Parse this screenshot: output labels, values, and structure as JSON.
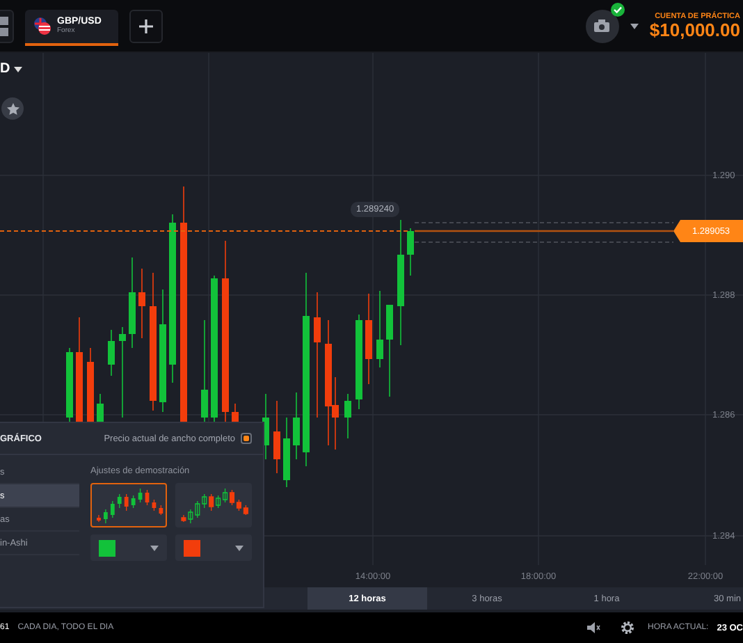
{
  "top_bar": {
    "tabs": [
      {
        "symbol": "GBP/USD",
        "market": "Forex",
        "selected": true
      }
    ],
    "account": {
      "label": "CUENTA DE PRÁCTICA",
      "balance": "$10,000.00"
    }
  },
  "chart": {
    "asset_label": "D",
    "price_labels": [
      "1.290",
      "1.288",
      "1.286",
      "1.284"
    ],
    "time_labels": [
      "14:00:00",
      "18:00:00",
      "22:00:00"
    ],
    "current_price": "1.289053",
    "hover_price": "1.289240"
  },
  "timeframes": [
    {
      "label": "12 horas",
      "selected": true
    },
    {
      "label": "3 horas",
      "selected": false
    },
    {
      "label": "1 hora",
      "selected": false
    },
    {
      "label": "30 min",
      "selected": false
    }
  ],
  "settings_panel": {
    "title": "GRÁFICO",
    "full_width_price": {
      "label": "Precio actual de ancho completo",
      "checked": true
    },
    "chart_types": [
      {
        "label": "s",
        "selected": false
      },
      {
        "label": "s",
        "selected": true
      },
      {
        "label": "as",
        "selected": false
      },
      {
        "label": "in-Ashi",
        "selected": false
      }
    ],
    "demo_label": "Ajustes de demostración",
    "styles": [
      {
        "kind": "filled",
        "selected": true
      },
      {
        "kind": "hollow",
        "selected": false
      }
    ],
    "colors": [
      {
        "color": "#12c23a"
      },
      {
        "color": "#f23d0c"
      }
    ]
  },
  "status_bar": {
    "left_text": "61",
    "schedule": "CADA DIA, TODO EL DIA",
    "time_label": "HORA ACTUAL:",
    "time_value": "23 OC"
  }
}
